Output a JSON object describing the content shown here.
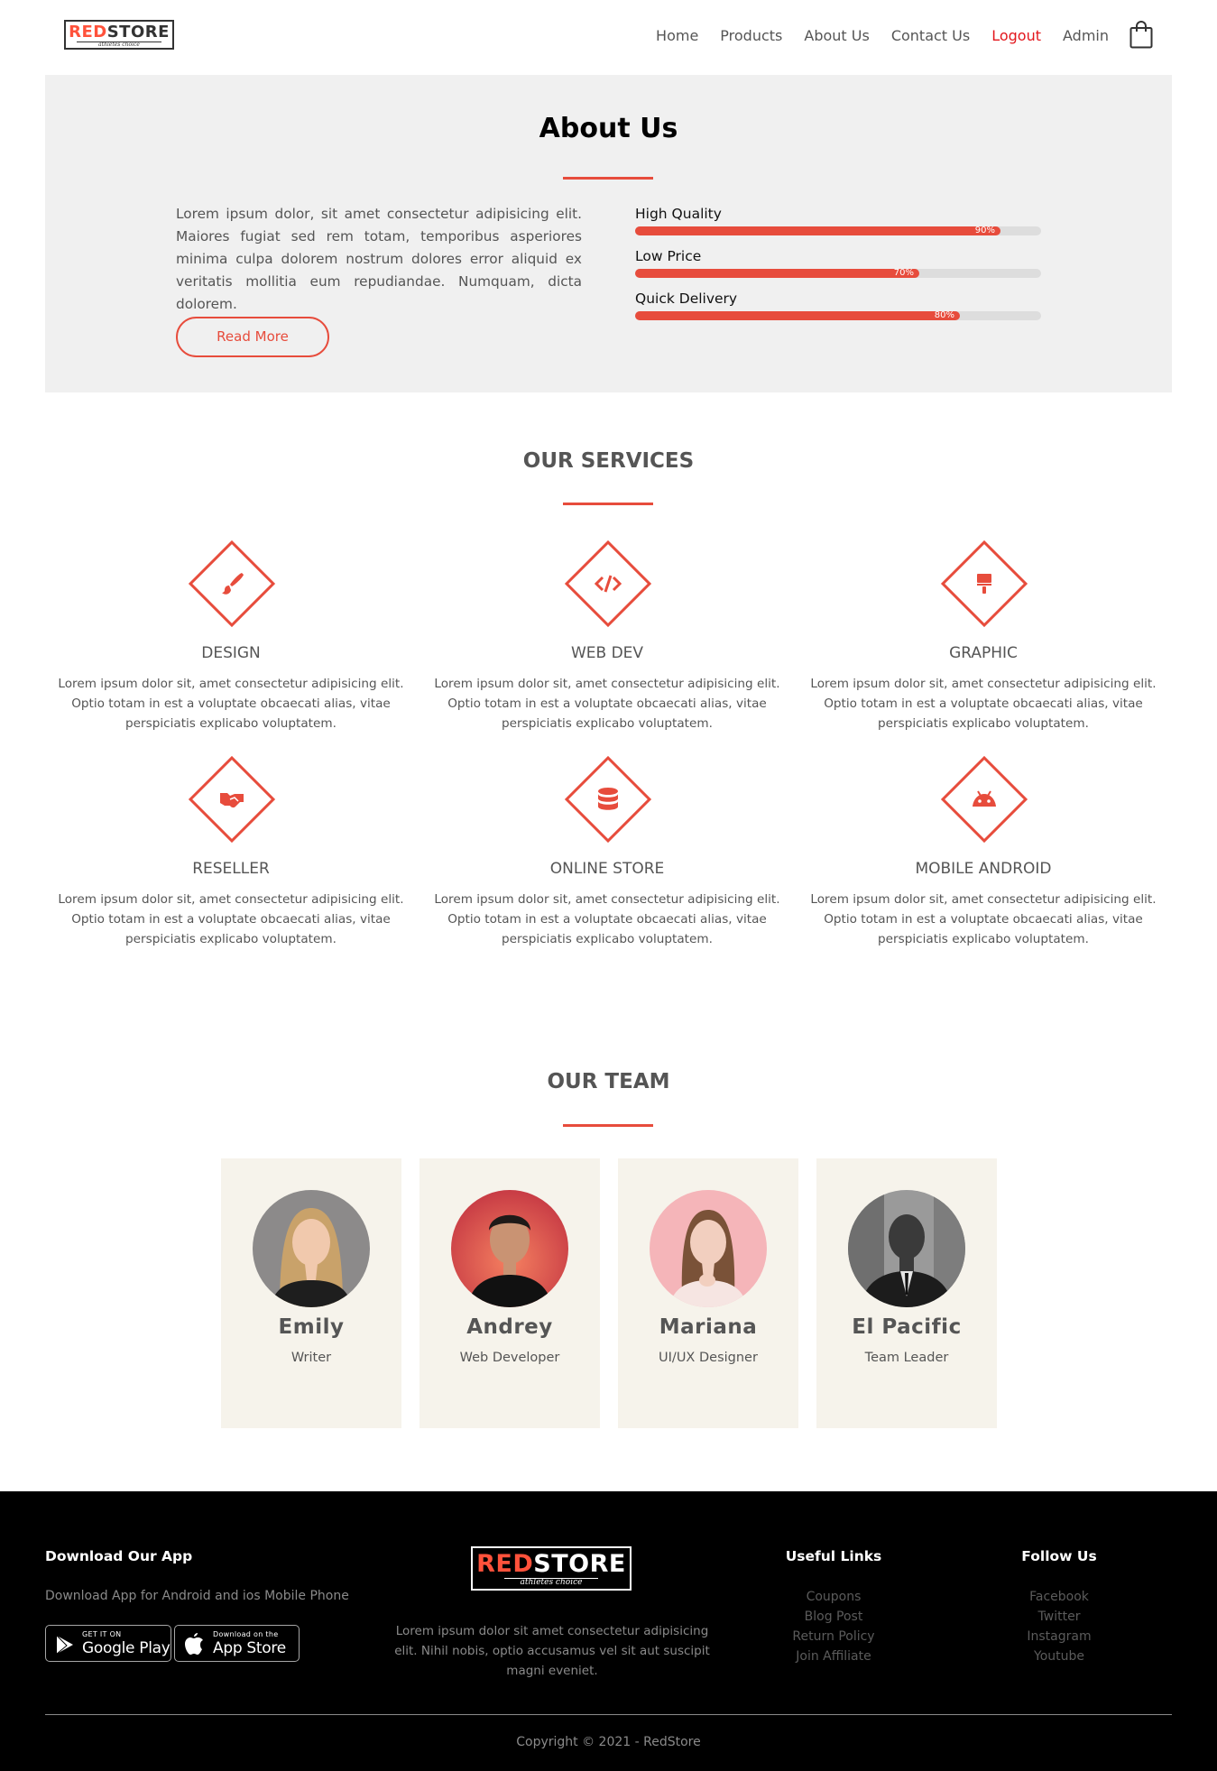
{
  "brand": {
    "name_red": "RED",
    "name_dark": "STORE",
    "tagline": "athletes choice"
  },
  "nav": {
    "items": [
      "Home",
      "Products",
      "About Us",
      "Contact Us",
      "Logout",
      "Admin"
    ],
    "active": "Logout"
  },
  "about": {
    "title": "About Us",
    "text": "Lorem ipsum dolor, sit amet consectetur adipisicing elit. Maiores fugiat sed rem totam, temporibus asperiores minima culpa dolorem nostrum dolores error aliquid ex veritatis mollitia eum repudiandae. Numquam, dicta dolorem.",
    "button": "Read More",
    "skills": [
      {
        "label": "High Quality",
        "percent": 90,
        "percent_text": "90%"
      },
      {
        "label": "Low Price",
        "percent": 70,
        "percent_text": "70%"
      },
      {
        "label": "Quick Delivery",
        "percent": 80,
        "percent_text": "80%"
      }
    ]
  },
  "services": {
    "title": "OUR SERVICES",
    "items": [
      {
        "name": "DESIGN",
        "icon": "paint-brush-icon",
        "desc": "Lorem ipsum dolor sit, amet consectetur adipisicing elit. Optio totam in est a voluptate obcaecati alias, vitae perspiciatis explicabo voluptatem."
      },
      {
        "name": "WEB DEV",
        "icon": "code-icon",
        "desc": "Lorem ipsum dolor sit, amet consectetur adipisicing elit. Optio totam in est a voluptate obcaecati alias, vitae perspiciatis explicabo voluptatem."
      },
      {
        "name": "GRAPHIC",
        "icon": "paint-roller-icon",
        "desc": "Lorem ipsum dolor sit, amet consectetur adipisicing elit. Optio totam in est a voluptate obcaecati alias, vitae perspiciatis explicabo voluptatem."
      },
      {
        "name": "RESELLER",
        "icon": "handshake-icon",
        "desc": "Lorem ipsum dolor sit, amet consectetur adipisicing elit. Optio totam in est a voluptate obcaecati alias, vitae perspiciatis explicabo voluptatem."
      },
      {
        "name": "ONLINE STORE",
        "icon": "database-icon",
        "desc": "Lorem ipsum dolor sit, amet consectetur adipisicing elit. Optio totam in est a voluptate obcaecati alias, vitae perspiciatis explicabo voluptatem."
      },
      {
        "name": "MOBILE ANDROID",
        "icon": "android-icon",
        "desc": "Lorem ipsum dolor sit, amet consectetur adipisicing elit. Optio totam in est a voluptate obcaecati alias, vitae perspiciatis explicabo voluptatem."
      }
    ]
  },
  "team": {
    "title": "OUR TEAM",
    "members": [
      {
        "name": "Emily",
        "role": "Writer"
      },
      {
        "name": "Andrey",
        "role": "Web Developer"
      },
      {
        "name": "Mariana",
        "role": "UI/UX Designer"
      },
      {
        "name": "El Pacific",
        "role": "Team Leader"
      }
    ]
  },
  "footer": {
    "download_title": "Download Our App",
    "download_text": "Download App for Android and ios Mobile Phone",
    "google_small": "GET IT ON",
    "google_big": "Google Play",
    "apple_small": "Download on the",
    "apple_big": "App Store",
    "about": "Lorem ipsum dolor sit amet consectetur adipisicing elit. Nihil nobis, optio accusamus vel sit aut suscipit magni eveniet.",
    "useful_title": "Useful Links",
    "useful_links": [
      "Coupons",
      "Blog Post",
      "Return Policy",
      "Join Affiliate"
    ],
    "follow_title": "Follow Us",
    "follow_links": [
      "Facebook",
      "Twitter",
      "Instagram",
      "Youtube"
    ],
    "copyright": "Copyright © 2021 - RedStore"
  },
  "colors": {
    "accent": "#e74c3c",
    "active_nav": "#e3171d",
    "about_bg": "#f0f0f0",
    "card_bg": "#f6f3eb",
    "footer_bg": "#000000"
  }
}
